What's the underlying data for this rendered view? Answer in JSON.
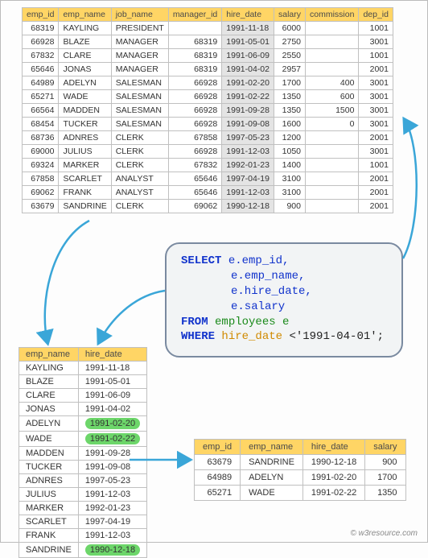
{
  "main": {
    "headers": [
      "emp_id",
      "emp_name",
      "job_name",
      "manager_id",
      "hire_date",
      "salary",
      "commission",
      "dep_id"
    ],
    "rows": [
      {
        "emp_id": 68319,
        "emp_name": "KAYLING",
        "job_name": "PRESIDENT",
        "manager_id": "",
        "hire_date": "1991-11-18",
        "salary": 6000,
        "commission": "",
        "dep_id": 1001
      },
      {
        "emp_id": 66928,
        "emp_name": "BLAZE",
        "job_name": "MANAGER",
        "manager_id": 68319,
        "hire_date": "1991-05-01",
        "salary": 2750,
        "commission": "",
        "dep_id": 3001
      },
      {
        "emp_id": 67832,
        "emp_name": "CLARE",
        "job_name": "MANAGER",
        "manager_id": 68319,
        "hire_date": "1991-06-09",
        "salary": 2550,
        "commission": "",
        "dep_id": 1001
      },
      {
        "emp_id": 65646,
        "emp_name": "JONAS",
        "job_name": "MANAGER",
        "manager_id": 68319,
        "hire_date": "1991-04-02",
        "salary": 2957,
        "commission": "",
        "dep_id": 2001
      },
      {
        "emp_id": 64989,
        "emp_name": "ADELYN",
        "job_name": "SALESMAN",
        "manager_id": 66928,
        "hire_date": "1991-02-20",
        "salary": 1700,
        "commission": 400,
        "dep_id": 3001
      },
      {
        "emp_id": 65271,
        "emp_name": "WADE",
        "job_name": "SALESMAN",
        "manager_id": 66928,
        "hire_date": "1991-02-22",
        "salary": 1350,
        "commission": 600,
        "dep_id": 3001
      },
      {
        "emp_id": 66564,
        "emp_name": "MADDEN",
        "job_name": "SALESMAN",
        "manager_id": 66928,
        "hire_date": "1991-09-28",
        "salary": 1350,
        "commission": 1500,
        "dep_id": 3001
      },
      {
        "emp_id": 68454,
        "emp_name": "TUCKER",
        "job_name": "SALESMAN",
        "manager_id": 66928,
        "hire_date": "1991-09-08",
        "salary": 1600,
        "commission": 0,
        "dep_id": 3001
      },
      {
        "emp_id": 68736,
        "emp_name": "ADNRES",
        "job_name": "CLERK",
        "manager_id": 67858,
        "hire_date": "1997-05-23",
        "salary": 1200,
        "commission": "",
        "dep_id": 2001
      },
      {
        "emp_id": 69000,
        "emp_name": "JULIUS",
        "job_name": "CLERK",
        "manager_id": 66928,
        "hire_date": "1991-12-03",
        "salary": 1050,
        "commission": "",
        "dep_id": 3001
      },
      {
        "emp_id": 69324,
        "emp_name": "MARKER",
        "job_name": "CLERK",
        "manager_id": 67832,
        "hire_date": "1992-01-23",
        "salary": 1400,
        "commission": "",
        "dep_id": 1001
      },
      {
        "emp_id": 67858,
        "emp_name": "SCARLET",
        "job_name": "ANALYST",
        "manager_id": 65646,
        "hire_date": "1997-04-19",
        "salary": 3100,
        "commission": "",
        "dep_id": 2001
      },
      {
        "emp_id": 69062,
        "emp_name": "FRANK",
        "job_name": "ANALYST",
        "manager_id": 65646,
        "hire_date": "1991-12-03",
        "salary": 3100,
        "commission": "",
        "dep_id": 2001
      },
      {
        "emp_id": 63679,
        "emp_name": "SANDRINE",
        "job_name": "CLERK",
        "manager_id": 69062,
        "hire_date": "1990-12-18",
        "salary": 900,
        "commission": "",
        "dep_id": 2001
      }
    ]
  },
  "sql": {
    "l1a": "SELECT ",
    "l1b": "e.emp_id,",
    "l2": "e.emp_name,",
    "l3": "e.hire_date,",
    "l4": "e.salary",
    "l5a": "FROM ",
    "l5b": "employees e",
    "l6a": "WHERE ",
    "l6b": "hire_date ",
    "l6c": "<'1991-04-01';"
  },
  "mini": {
    "headers": [
      "emp_name",
      "hire_date"
    ],
    "rows": [
      {
        "emp_name": "KAYLING",
        "hire_date": "1991-11-18",
        "hl": false
      },
      {
        "emp_name": "BLAZE",
        "hire_date": "1991-05-01",
        "hl": false
      },
      {
        "emp_name": "CLARE",
        "hire_date": "1991-06-09",
        "hl": false
      },
      {
        "emp_name": "JONAS",
        "hire_date": "1991-04-02",
        "hl": false
      },
      {
        "emp_name": "ADELYN",
        "hire_date": "1991-02-20",
        "hl": true
      },
      {
        "emp_name": "WADE",
        "hire_date": "1991-02-22",
        "hl": true
      },
      {
        "emp_name": "MADDEN",
        "hire_date": "1991-09-28",
        "hl": false
      },
      {
        "emp_name": "TUCKER",
        "hire_date": "1991-09-08",
        "hl": false
      },
      {
        "emp_name": "ADNRES",
        "hire_date": "1997-05-23",
        "hl": false
      },
      {
        "emp_name": "JULIUS",
        "hire_date": "1991-12-03",
        "hl": false
      },
      {
        "emp_name": "MARKER",
        "hire_date": "1992-01-23",
        "hl": false
      },
      {
        "emp_name": "SCARLET",
        "hire_date": "1997-04-19",
        "hl": false
      },
      {
        "emp_name": "FRANK",
        "hire_date": "1991-12-03",
        "hl": false
      },
      {
        "emp_name": "SANDRINE",
        "hire_date": "1990-12-18",
        "hl": true
      }
    ]
  },
  "result": {
    "headers": [
      "emp_id",
      "emp_name",
      "hire_date",
      "salary"
    ],
    "rows": [
      {
        "emp_id": 63679,
        "emp_name": "SANDRINE",
        "hire_date": "1990-12-18",
        "salary": 900
      },
      {
        "emp_id": 64989,
        "emp_name": "ADELYN",
        "hire_date": "1991-02-20",
        "salary": 1700
      },
      {
        "emp_id": 65271,
        "emp_name": "WADE",
        "hire_date": "1991-02-22",
        "salary": 1350
      }
    ]
  },
  "footer": "© w3resource.com"
}
